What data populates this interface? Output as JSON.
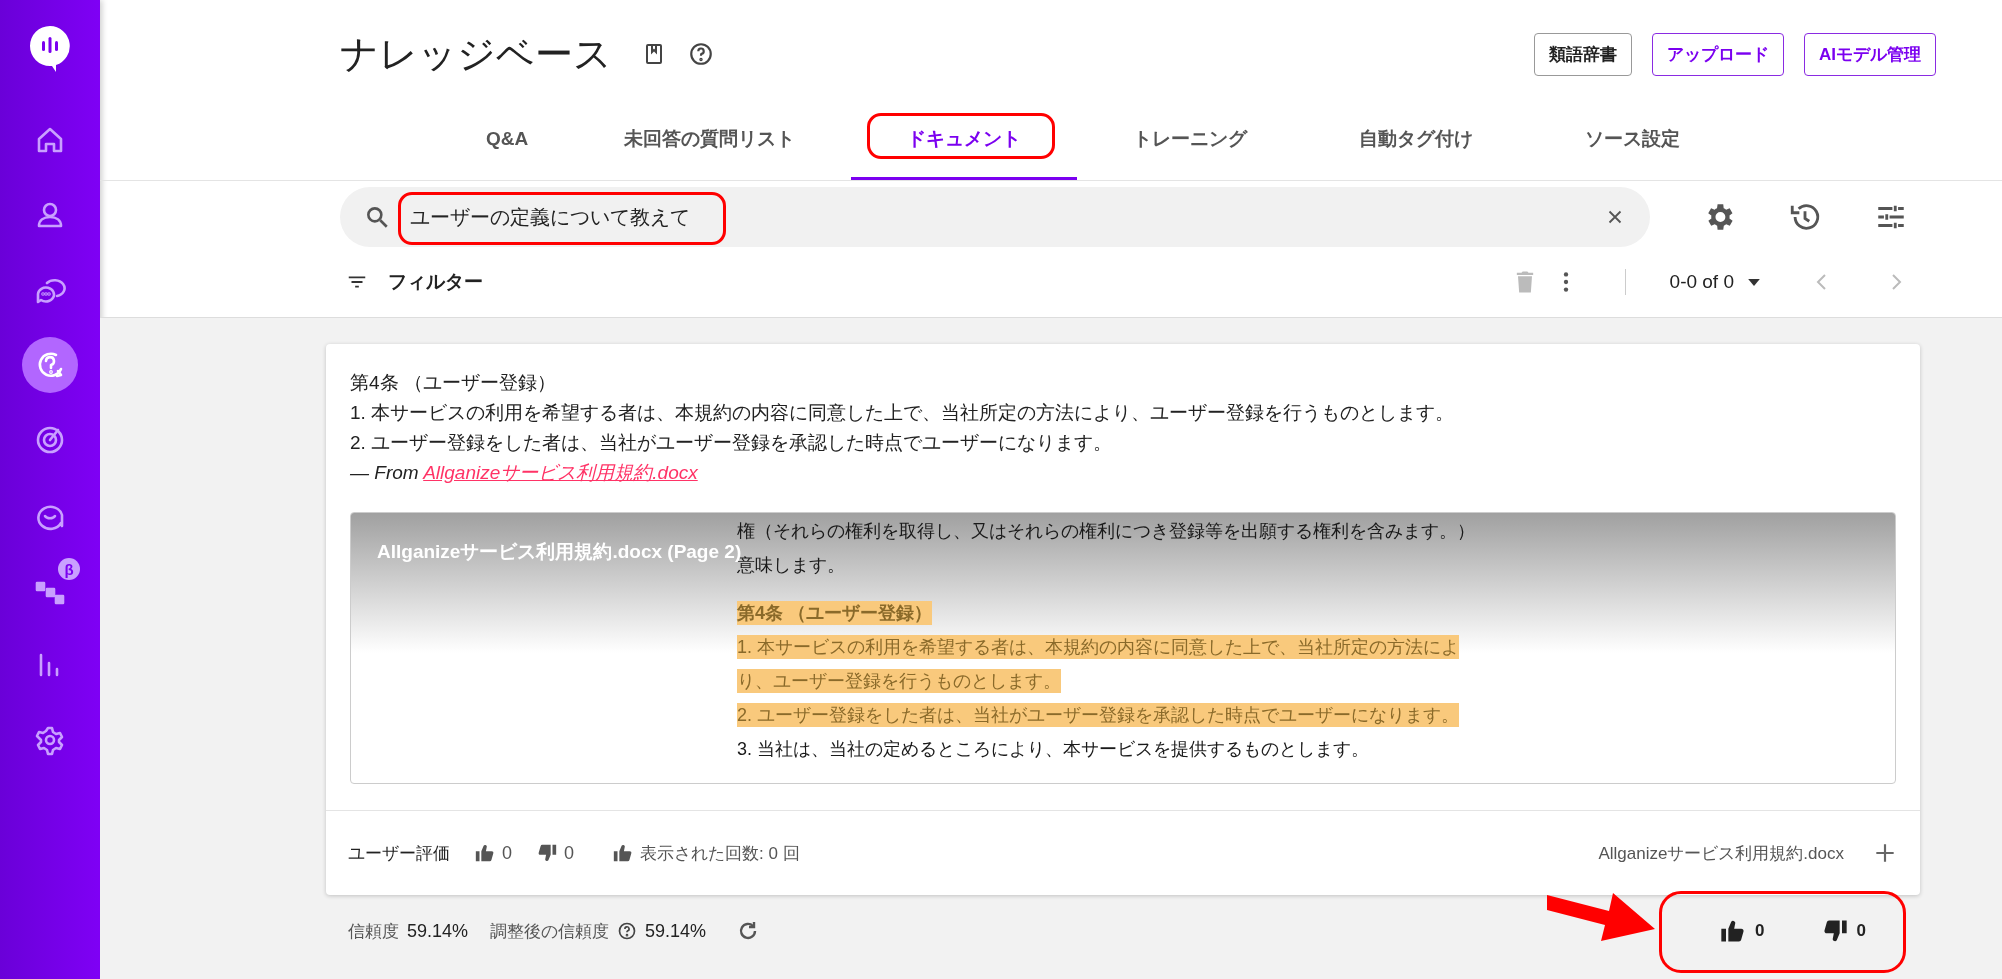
{
  "sidebar": {
    "items": [
      {
        "kind": "home",
        "selected": false
      },
      {
        "kind": "person",
        "selected": false
      },
      {
        "kind": "chat",
        "selected": false
      },
      {
        "kind": "question",
        "selected": true
      },
      {
        "kind": "target",
        "selected": false
      },
      {
        "kind": "smile",
        "selected": false
      },
      {
        "kind": "flow",
        "selected": false,
        "badge": "β"
      },
      {
        "kind": "bars",
        "selected": false
      },
      {
        "kind": "gear",
        "selected": false
      }
    ]
  },
  "header": {
    "title": "ナレッジベース",
    "buttons": [
      {
        "label": "類語辞書",
        "kind": "default"
      },
      {
        "label": "アップロード",
        "kind": "primary"
      },
      {
        "label": "AIモデル管理",
        "kind": "primary"
      }
    ]
  },
  "tabs": [
    {
      "label": "Q&A",
      "selected": false,
      "highlighted": false
    },
    {
      "label": "未回答の質問リスト",
      "selected": false,
      "highlighted": false
    },
    {
      "label": "ドキュメント",
      "selected": true,
      "highlighted": true
    },
    {
      "label": "トレーニング",
      "selected": false,
      "highlighted": false
    },
    {
      "label": "自動タグ付け",
      "selected": false,
      "highlighted": false
    },
    {
      "label": "ソース設定",
      "selected": false,
      "highlighted": false
    }
  ],
  "search": {
    "value": "ユーザーの定義について教えて",
    "highlighted": true
  },
  "toolbar": {
    "filter_label": "フィルター",
    "pagination": "0-0 of 0"
  },
  "result": {
    "heading": "第4条 （ユーザー登録）",
    "lines": [
      "1. 本サービスの利用を希望する者は、本規約の内容に同意した上で、当社所定の方法により、ユーザー登録を行うものとします。",
      "2. ユーザー登録をした者は、当社がユーザー登録を承認した時点でユーザーになります。"
    ],
    "source_prefix": "— From",
    "source_link": "Allganizeサービス利用規約.docx",
    "preview": {
      "title": "Allganizeサービス利用規約.docx (Page 2)",
      "lines": [
        {
          "text": "権（それらの権利を取得し、又はそれらの権利につき登録等を出願する権利を含みます。）",
          "kind": "plain"
        },
        {
          "text": "意味します。",
          "kind": "plain"
        },
        {
          "text": "第4条 （ユーザー登録）",
          "kind": "heading"
        },
        {
          "text": "1. 本サービスの利用を希望する者は、本規約の内容に同意した上で、当社所定の方法によ",
          "kind": "highlighted"
        },
        {
          "text": "り、ユーザー登録を行うものとします。",
          "kind": "highlighted"
        },
        {
          "text": "2. ユーザー登録をした者は、当社がユーザー登録を承認した時点でユーザーになります。",
          "kind": "highlighted"
        },
        {
          "text": "3. 当社は、当社の定めるところにより、本サービスを提供するものとします。",
          "kind": "plain"
        }
      ]
    },
    "footer": {
      "rating_label": "ユーザー評価",
      "likes": "0",
      "dislikes": "0",
      "views": "表示された回数: 0 回",
      "file": "Allganizeサービス利用規約.docx"
    }
  },
  "confidence": {
    "label": "信頼度",
    "value": "59.14%",
    "adjusted_label": "調整後の信頼度",
    "adjusted_value": "59.14%"
  },
  "feedback": {
    "likes": "0",
    "dislikes": "0",
    "highlighted": true,
    "arrow": true
  }
}
